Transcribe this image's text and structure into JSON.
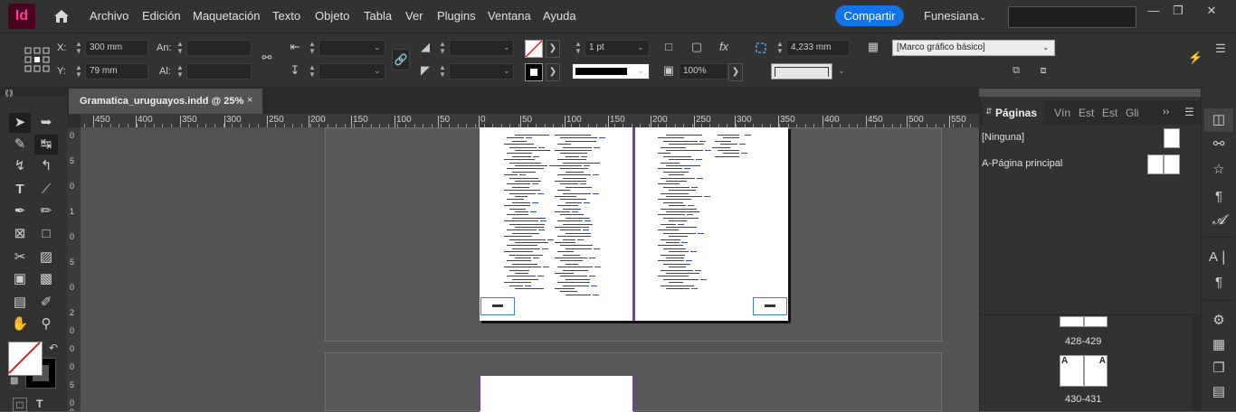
{
  "app": {
    "logo": "Id",
    "menu": [
      "Archivo",
      "Edición",
      "Maquetación",
      "Texto",
      "Objeto",
      "Tabla",
      "Ver",
      "Plugins",
      "Ventana",
      "Ayuda"
    ],
    "share_label": "Compartir",
    "workspace": "Funesiana",
    "search_placeholder": ""
  },
  "control": {
    "x_label": "X:",
    "y_label": "Y:",
    "x_value": "300 mm",
    "y_value": "79 mm",
    "w_label": "An:",
    "h_label": "Al:",
    "w_value": "",
    "h_value": "",
    "stroke_weight": "1 pt",
    "scale_percent": "100%",
    "offset_value": "4,233 mm",
    "object_style": "[Marco gráfico básico]"
  },
  "document": {
    "tab_title": "Gramatica_uruguayos.indd @ 25%",
    "close_glyph": "×"
  },
  "ruler": {
    "h_labels": [
      "450",
      "400",
      "350",
      "300",
      "250",
      "200",
      "150",
      "100",
      "50",
      "0",
      "50",
      "100",
      "150",
      "200",
      "250",
      "300",
      "350",
      "400",
      "450",
      "500",
      "550"
    ],
    "v_labels": [
      "0",
      "5",
      "0",
      "1",
      "0",
      "5",
      "0",
      "2",
      "0",
      "0",
      "0",
      "5",
      "0",
      "0"
    ]
  },
  "pages_panel": {
    "tabs": [
      "Páginas",
      "Vín",
      "Est",
      "Est",
      "Gli"
    ],
    "none_label": "[Ninguna]",
    "master_label": "A-Página principal",
    "spread_1": "428-429",
    "spread_2": "430-431",
    "master_letter": "A"
  },
  "colors": {
    "accent": "#1473e6",
    "brand": "#ff3e9c",
    "brand_bg": "#49021f",
    "margin": "#7a3aa8",
    "folio_frame": "#3f7bd8"
  }
}
